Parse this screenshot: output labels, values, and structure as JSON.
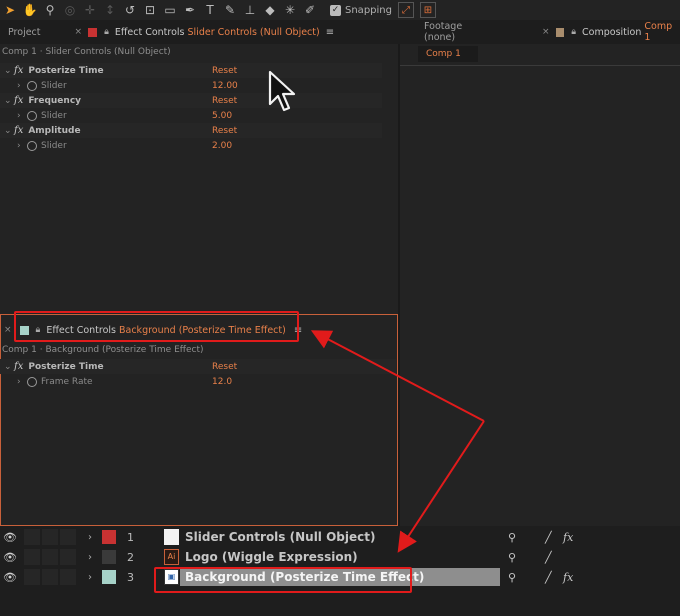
{
  "toolbar": {
    "snapping_label": "Snapping",
    "tools": [
      "selection-tool",
      "hand-tool",
      "zoom-tool",
      "orbit-tool",
      "pan-tool",
      "dolly-tool",
      "rotate-tool",
      "pan-behind-tool",
      "rectangle-tool",
      "pen-tool",
      "type-tool",
      "brush-tool",
      "clone-stamp-tool",
      "eraser-tool",
      "roto-brush-tool",
      "puppet-pin-tool"
    ]
  },
  "left_tabs": {
    "project_label": "Project",
    "effect_controls_prefix": "Effect Controls",
    "effect_controls_target": "Slider Controls (Null Object)"
  },
  "right_tabs": {
    "footage_label": "Footage (none)",
    "composition_prefix": "Composition",
    "composition_target": "Comp 1",
    "comp_subtab": "Comp 1"
  },
  "upper_panel": {
    "breadcrumb": "Comp 1 · Slider Controls (Null Object)",
    "effects": [
      {
        "name": "Posterize Time",
        "reset": "Reset",
        "prop": "Slider",
        "value": "12.00"
      },
      {
        "name": "Frequency",
        "reset": "Reset",
        "prop": "Slider",
        "value": "5.00"
      },
      {
        "name": "Amplitude",
        "reset": "Reset",
        "prop": "Slider",
        "value": "2.00"
      }
    ]
  },
  "lower_panel": {
    "tab_prefix": "Effect Controls",
    "tab_target": "Background (Posterize Time Effect)",
    "breadcrumb": "Comp 1 · Background (Posterize Time Effect)",
    "effect": {
      "name": "Posterize Time",
      "reset": "Reset",
      "prop": "Frame Rate",
      "value": "12.0"
    }
  },
  "timeline": {
    "layers": [
      {
        "num": "1",
        "name": "Slider Controls (Null Object)",
        "color": "#c83232"
      },
      {
        "num": "2",
        "name": "Logo (Wiggle Expression)",
        "color": "#3a3a3a"
      },
      {
        "num": "3",
        "name": "Background (Posterize Time Effect)",
        "color": "#a6d2c8"
      }
    ]
  },
  "colors": {
    "accent": "#e8804a",
    "annotation_red": "#e11b1b"
  }
}
